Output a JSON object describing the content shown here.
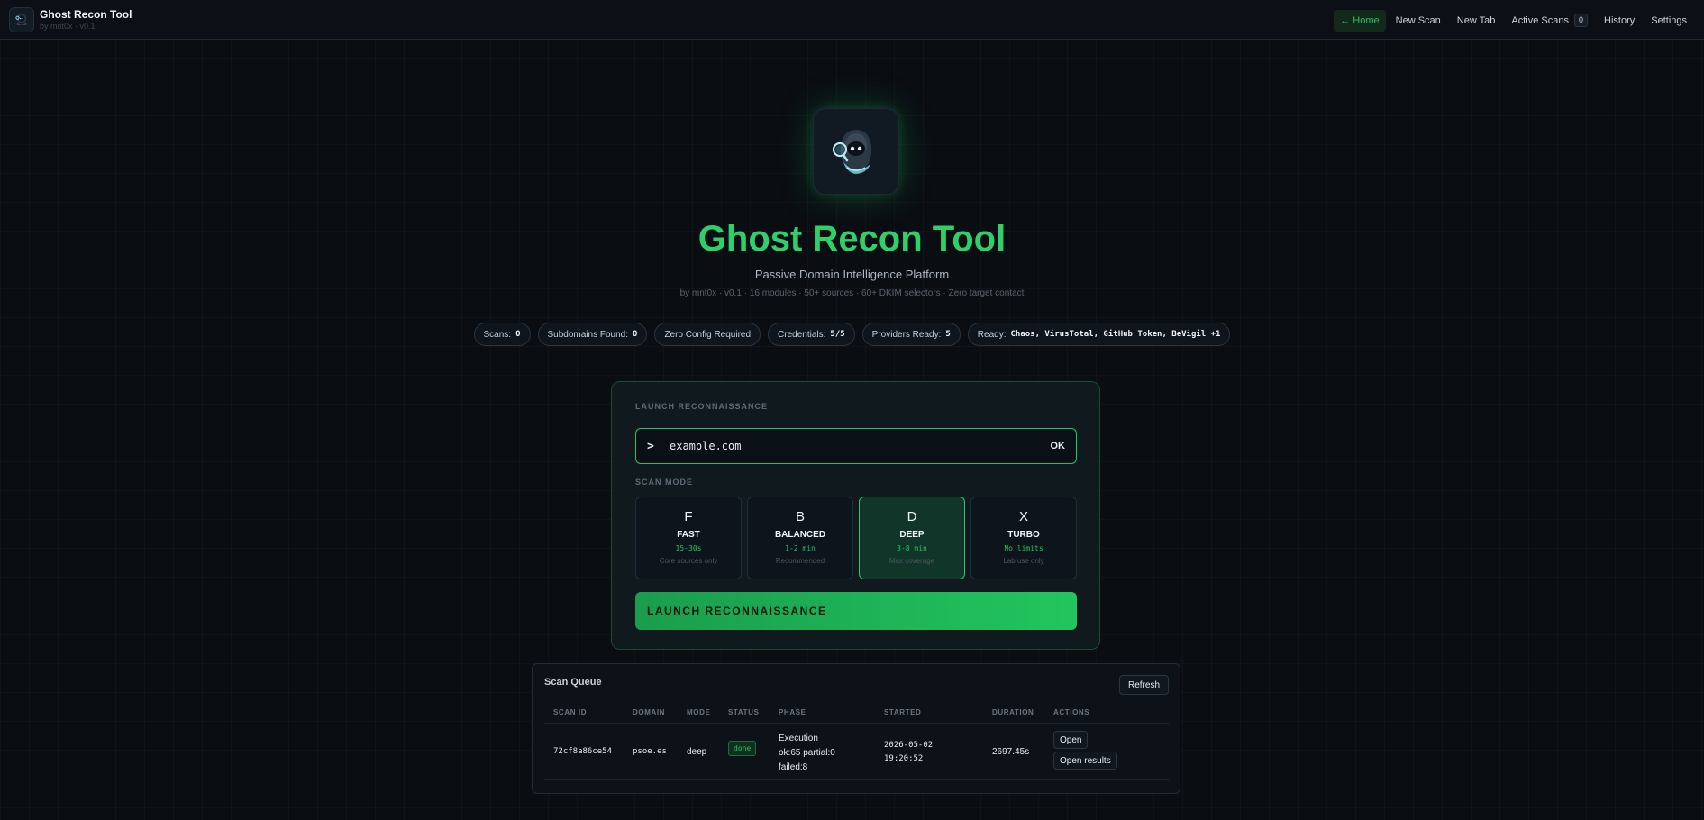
{
  "app": {
    "title": "Ghost Recon Tool",
    "subtitle": "by mnt0x · v0.1"
  },
  "nav": {
    "home": "← Home",
    "new_scan": "New Scan",
    "new_tab": "New Tab",
    "active_scans": "Active Scans",
    "active_scans_count": "0",
    "history": "History",
    "settings": "Settings"
  },
  "hero": {
    "title": "Ghost Recon Tool",
    "tagline": "Passive Domain Intelligence Platform",
    "meta": "by mnt0x · v0.1 · 16 modules · 50+ sources · 60+ DKIM selectors · Zero target contact"
  },
  "stats": {
    "scans_label": "Scans:",
    "scans_value": "0",
    "subdomains_label": "Subdomains Found:",
    "subdomains_value": "0",
    "zero_config": "Zero Config Required",
    "credentials_label": "Credentials:",
    "credentials_value": "5/5",
    "providers_label": "Providers Ready:",
    "providers_value": "5",
    "ready_label": "Ready:",
    "ready_value": "Chaos, VirusTotal, GitHub Token, BeVigil +1"
  },
  "launch": {
    "section_label": "LAUNCH RECONNAISSANCE",
    "prompt": ">",
    "target_value": "example.com",
    "ok_label": "OK",
    "scan_mode_label": "SCAN MODE",
    "modes": [
      {
        "letter": "F",
        "name": "FAST",
        "time": "15-30s",
        "desc": "Core sources only"
      },
      {
        "letter": "B",
        "name": "BALANCED",
        "time": "1-2 min",
        "desc": "Recommended"
      },
      {
        "letter": "D",
        "name": "DEEP",
        "time": "3-8 min",
        "desc": "Max coverage"
      },
      {
        "letter": "X",
        "name": "TURBO",
        "time": "No limits",
        "desc": "Lab use only"
      }
    ],
    "selected_mode": "DEEP",
    "button_label": "LAUNCH RECONNAISSANCE"
  },
  "queue": {
    "title": "Scan Queue",
    "refresh_label": "Refresh",
    "columns": [
      "SCAN ID",
      "DOMAIN",
      "MODE",
      "STATUS",
      "PHASE",
      "STARTED",
      "DURATION",
      "ACTIONS"
    ],
    "rows": [
      {
        "scan_id": "72cf8a86ce54",
        "domain": "psoe.es",
        "mode": "deep",
        "status": "done",
        "phase_line1": "Execution",
        "phase_line2": "ok:65 partial:0",
        "phase_line3": "failed:8",
        "started_date": "2026-05-02",
        "started_time": "19:20:52",
        "duration": "2697.45s",
        "action_open": "Open",
        "action_results": "Open results"
      }
    ]
  },
  "colors": {
    "accent": "#22c55e",
    "background": "#0a0d12",
    "card_border": "#1d4a33"
  }
}
